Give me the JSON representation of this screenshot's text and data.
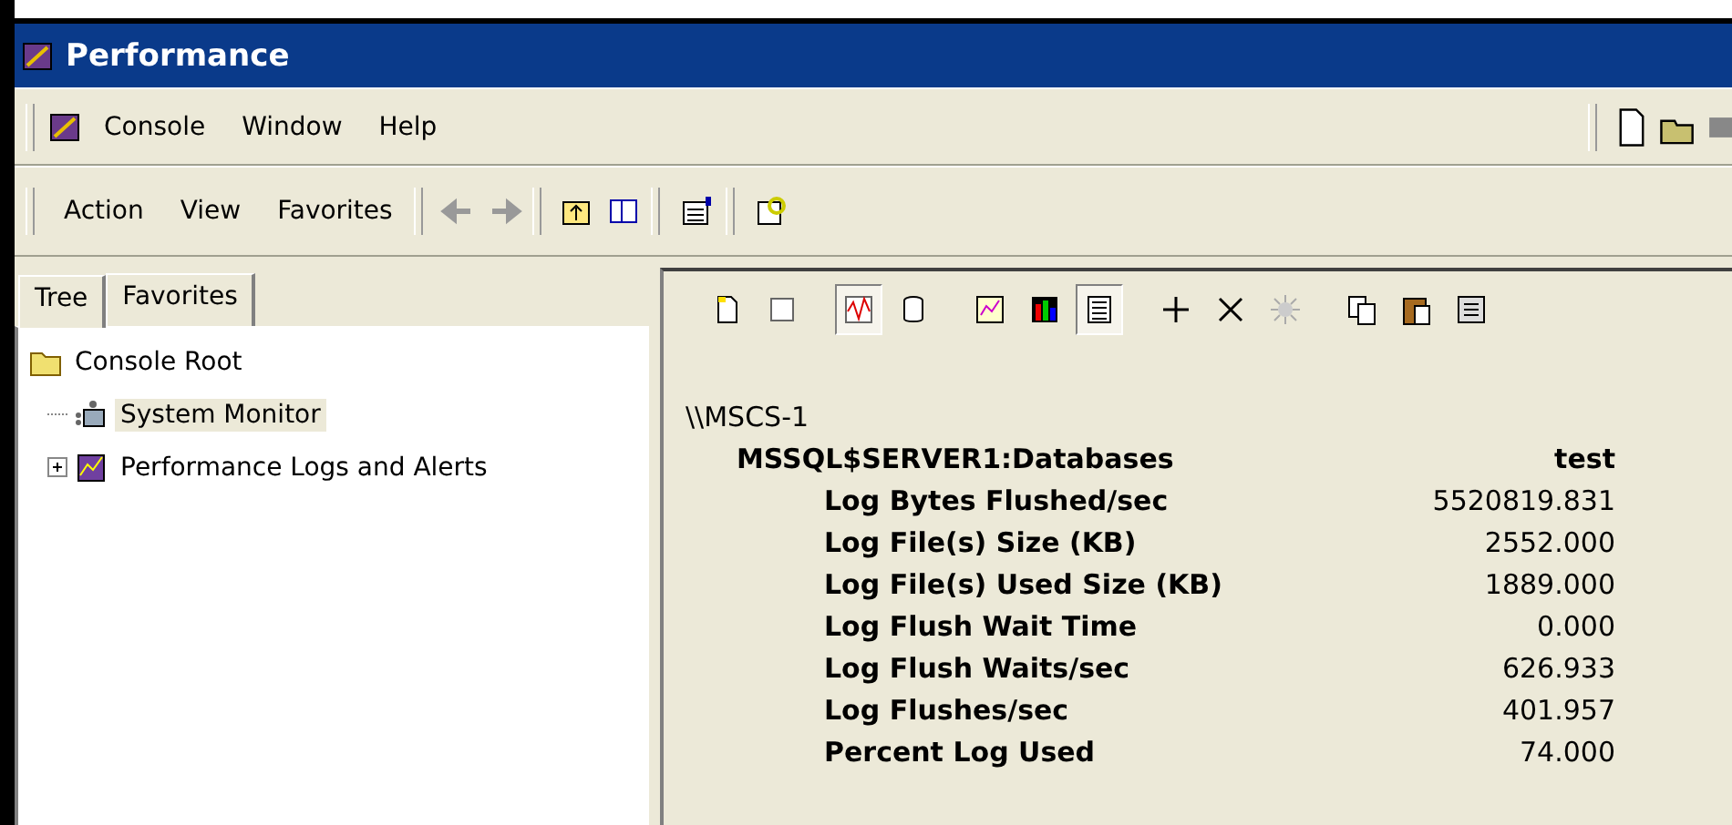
{
  "window": {
    "title": "Performance"
  },
  "menu_bar": [
    "Console",
    "Window",
    "Help"
  ],
  "action_bar": [
    "Action",
    "View",
    "Favorites"
  ],
  "tabs": [
    {
      "label": "Tree",
      "selected": true
    },
    {
      "label": "Favorites",
      "selected": false
    }
  ],
  "tree": [
    {
      "label": "Console Root",
      "selected": false,
      "children": [
        {
          "label": "System Monitor",
          "selected": true,
          "expandable": false
        },
        {
          "label": "Performance Logs and Alerts",
          "selected": false,
          "expandable": true
        }
      ]
    }
  ],
  "monitor_toolbar": [
    {
      "kind": "new",
      "pressed": false
    },
    {
      "kind": "clear",
      "pressed": false
    },
    {
      "kind": "sep"
    },
    {
      "kind": "current",
      "pressed": true
    },
    {
      "kind": "log",
      "pressed": false
    },
    {
      "kind": "sep"
    },
    {
      "kind": "graph",
      "pressed": false
    },
    {
      "kind": "histogram",
      "pressed": false
    },
    {
      "kind": "report",
      "pressed": true
    },
    {
      "kind": "sep"
    },
    {
      "kind": "add",
      "pressed": false
    },
    {
      "kind": "delete",
      "pressed": false
    },
    {
      "kind": "highlight",
      "pressed": false
    },
    {
      "kind": "sep"
    },
    {
      "kind": "copy",
      "pressed": false
    },
    {
      "kind": "paste",
      "pressed": false
    },
    {
      "kind": "props",
      "pressed": false
    }
  ],
  "report": {
    "computer": "\\\\MSCS-1",
    "object": "MSSQL$SERVER1:Databases",
    "instance": "test",
    "counters": [
      {
        "name": "Log Bytes Flushed/sec",
        "value": "5520819.831"
      },
      {
        "name": "Log File(s) Size (KB)",
        "value": "2552.000"
      },
      {
        "name": "Log File(s) Used Size (KB)",
        "value": "1889.000"
      },
      {
        "name": "Log Flush Wait Time",
        "value": "0.000"
      },
      {
        "name": "Log Flush Waits/sec",
        "value": "626.933"
      },
      {
        "name": "Log Flushes/sec",
        "value": "401.957"
      },
      {
        "name": "Percent Log Used",
        "value": "74.000"
      }
    ]
  }
}
